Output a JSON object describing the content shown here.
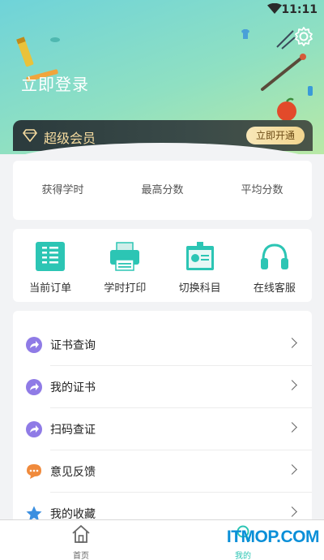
{
  "status_bar": {
    "time": "11:11"
  },
  "header": {
    "login_text": "立即登录",
    "vip": {
      "label": "超级会员",
      "button": "立即开通"
    }
  },
  "stats": {
    "items": [
      {
        "label": "获得学时"
      },
      {
        "label": "最高分数"
      },
      {
        "label": "平均分数"
      }
    ]
  },
  "actions": {
    "items": [
      {
        "label": "当前订单",
        "icon": "order-list-icon"
      },
      {
        "label": "学时打印",
        "icon": "printer-icon"
      },
      {
        "label": "切换科目",
        "icon": "id-card-icon"
      },
      {
        "label": "在线客服",
        "icon": "headset-icon"
      }
    ]
  },
  "menu": {
    "items": [
      {
        "label": "证书查询",
        "icon": "share-arrow-icon",
        "color": "#8f7be6"
      },
      {
        "label": "我的证书",
        "icon": "share-arrow-icon",
        "color": "#8f7be6"
      },
      {
        "label": "扫码查证",
        "icon": "share-arrow-icon",
        "color": "#8f7be6"
      },
      {
        "label": "意见反馈",
        "icon": "chat-bubble-icon",
        "color": "#f08a3c"
      },
      {
        "label": "我的收藏",
        "icon": "star-icon",
        "color": "#3b8fe0"
      }
    ]
  },
  "bottom_nav": {
    "items": [
      {
        "label": "首页",
        "icon": "home-icon"
      },
      {
        "label": "我的",
        "icon": "profile-icon"
      }
    ]
  },
  "watermark": "ITMOP.COM",
  "colors": {
    "accent": "#2cc5b4",
    "vip_gold": "#f6dca0",
    "watermark": "#0a8fd8"
  }
}
